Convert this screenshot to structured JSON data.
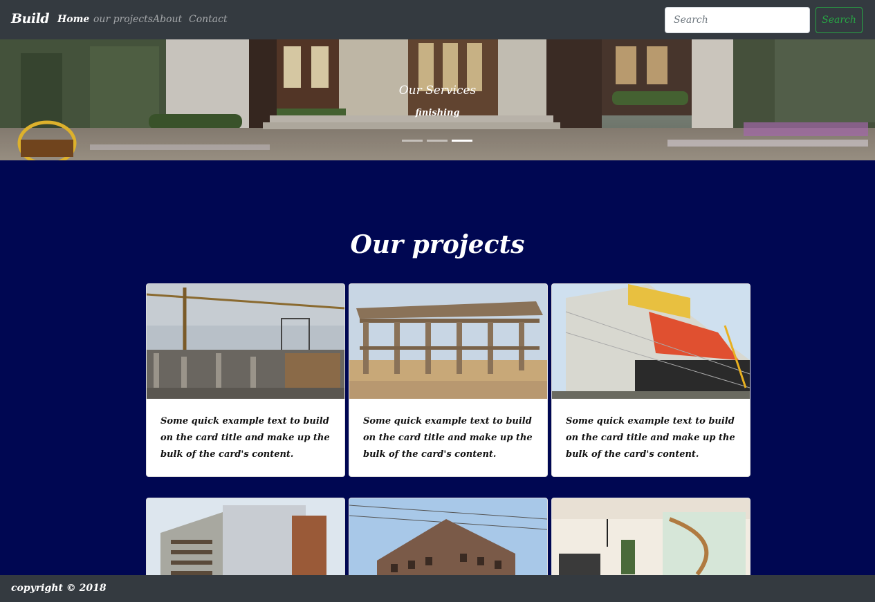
{
  "navbar": {
    "brand": "Build",
    "links": [
      {
        "label": "Home"
      },
      {
        "label": "our projects"
      },
      {
        "label": "About"
      },
      {
        "label": "Contact"
      }
    ],
    "search": {
      "placeholder": "Search",
      "button_label": "Search"
    }
  },
  "carousel": {
    "caption_title": "Our Services",
    "caption_subtitle": "finishing",
    "slide_count": 3,
    "active_slide": 3
  },
  "projects": {
    "title": "Our projects",
    "cards": [
      {
        "text": "Some quick example text to build on the card title and make up the bulk of the card's content."
      },
      {
        "text": "Some quick example text to build on the card title and make up the bulk of the card's content."
      },
      {
        "text": "Some quick example text to build on the card title and make up the bulk of the card's content."
      },
      {
        "text": ""
      },
      {
        "text": ""
      },
      {
        "text": ""
      }
    ]
  },
  "footer": {
    "text": "copyright © 2018"
  },
  "colors": {
    "navbar_bg": "#343a40",
    "page_bg": "#000752",
    "search_button": "#28a745"
  }
}
